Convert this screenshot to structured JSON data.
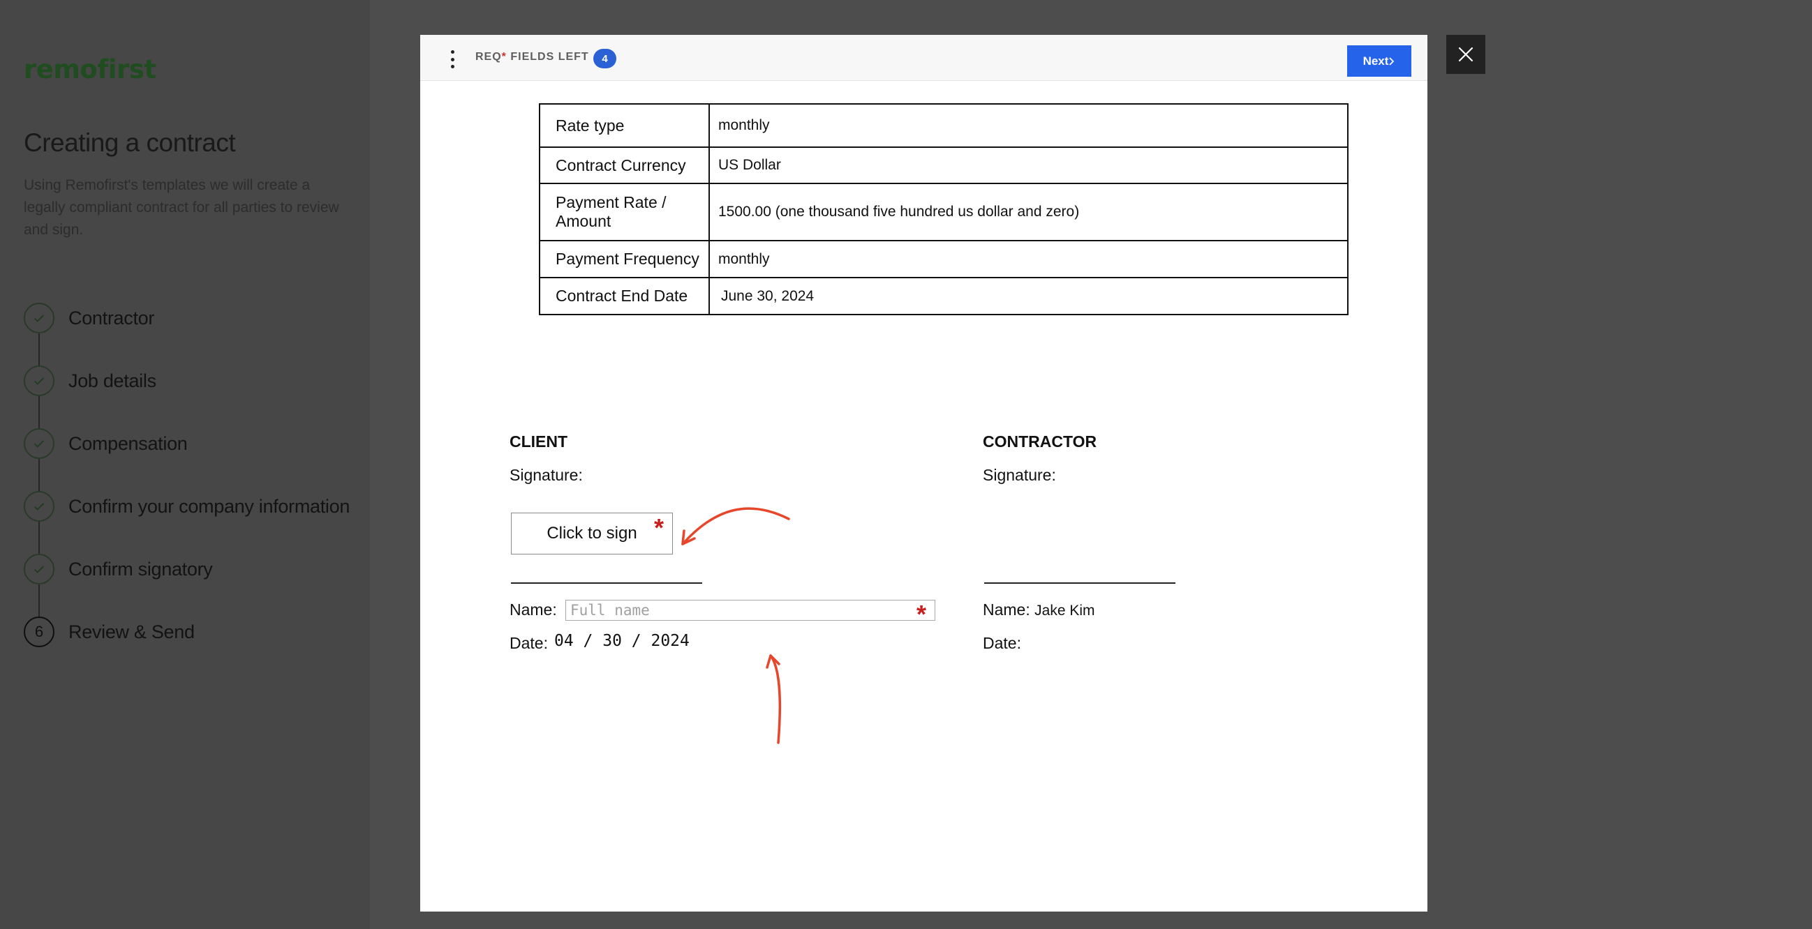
{
  "sidebar": {
    "logo": "remofirst",
    "title": "Creating a contract",
    "description": "Using Remofirst's templates we will create a legally compliant contract for all parties to review and sign.",
    "steps": [
      {
        "label": "Contractor",
        "status": "done"
      },
      {
        "label": "Job details",
        "status": "done"
      },
      {
        "label": "Compensation",
        "status": "done"
      },
      {
        "label": "Confirm your company information",
        "status": "done"
      },
      {
        "label": "Confirm signatory",
        "status": "done"
      },
      {
        "label": "Review & Send",
        "status": "active",
        "number": "6"
      }
    ]
  },
  "modal": {
    "header": {
      "req_prefix": "REQ",
      "req_star": "*",
      "req_suffix": " FIELDS LEFT",
      "fields_left": "4",
      "next_label": "Next",
      "next_icon": "chevron-right-icon"
    },
    "terms": [
      {
        "key": "Rate type",
        "value": "monthly"
      },
      {
        "key": "Contract Currency",
        "value": "US Dollar"
      },
      {
        "key": "Payment Rate / Amount",
        "value": "1500.00 (one thousand five hundred us dollar and zero)"
      },
      {
        "key": "Payment Frequency",
        "value": "monthly"
      },
      {
        "key": "Contract End Date",
        "value": "June 30, 2024"
      }
    ],
    "client": {
      "heading": "CLIENT",
      "signature_label": "Signature:",
      "sign_button": "Click to sign",
      "required_mark": "*",
      "name_label": "Name:",
      "name_placeholder": "Full name",
      "date_label": "Date:",
      "date_value": "04 / 30 / 2024"
    },
    "contractor": {
      "heading": "CONTRACTOR",
      "signature_label": "Signature:",
      "name_label": "Name:",
      "name_value": "Jake Kim",
      "date_label": "Date:"
    }
  },
  "colors": {
    "accent": "#2563eb",
    "required": "#c81e1e",
    "annotation_arrow": "#e8462a",
    "logo": "#1f4d1f"
  }
}
